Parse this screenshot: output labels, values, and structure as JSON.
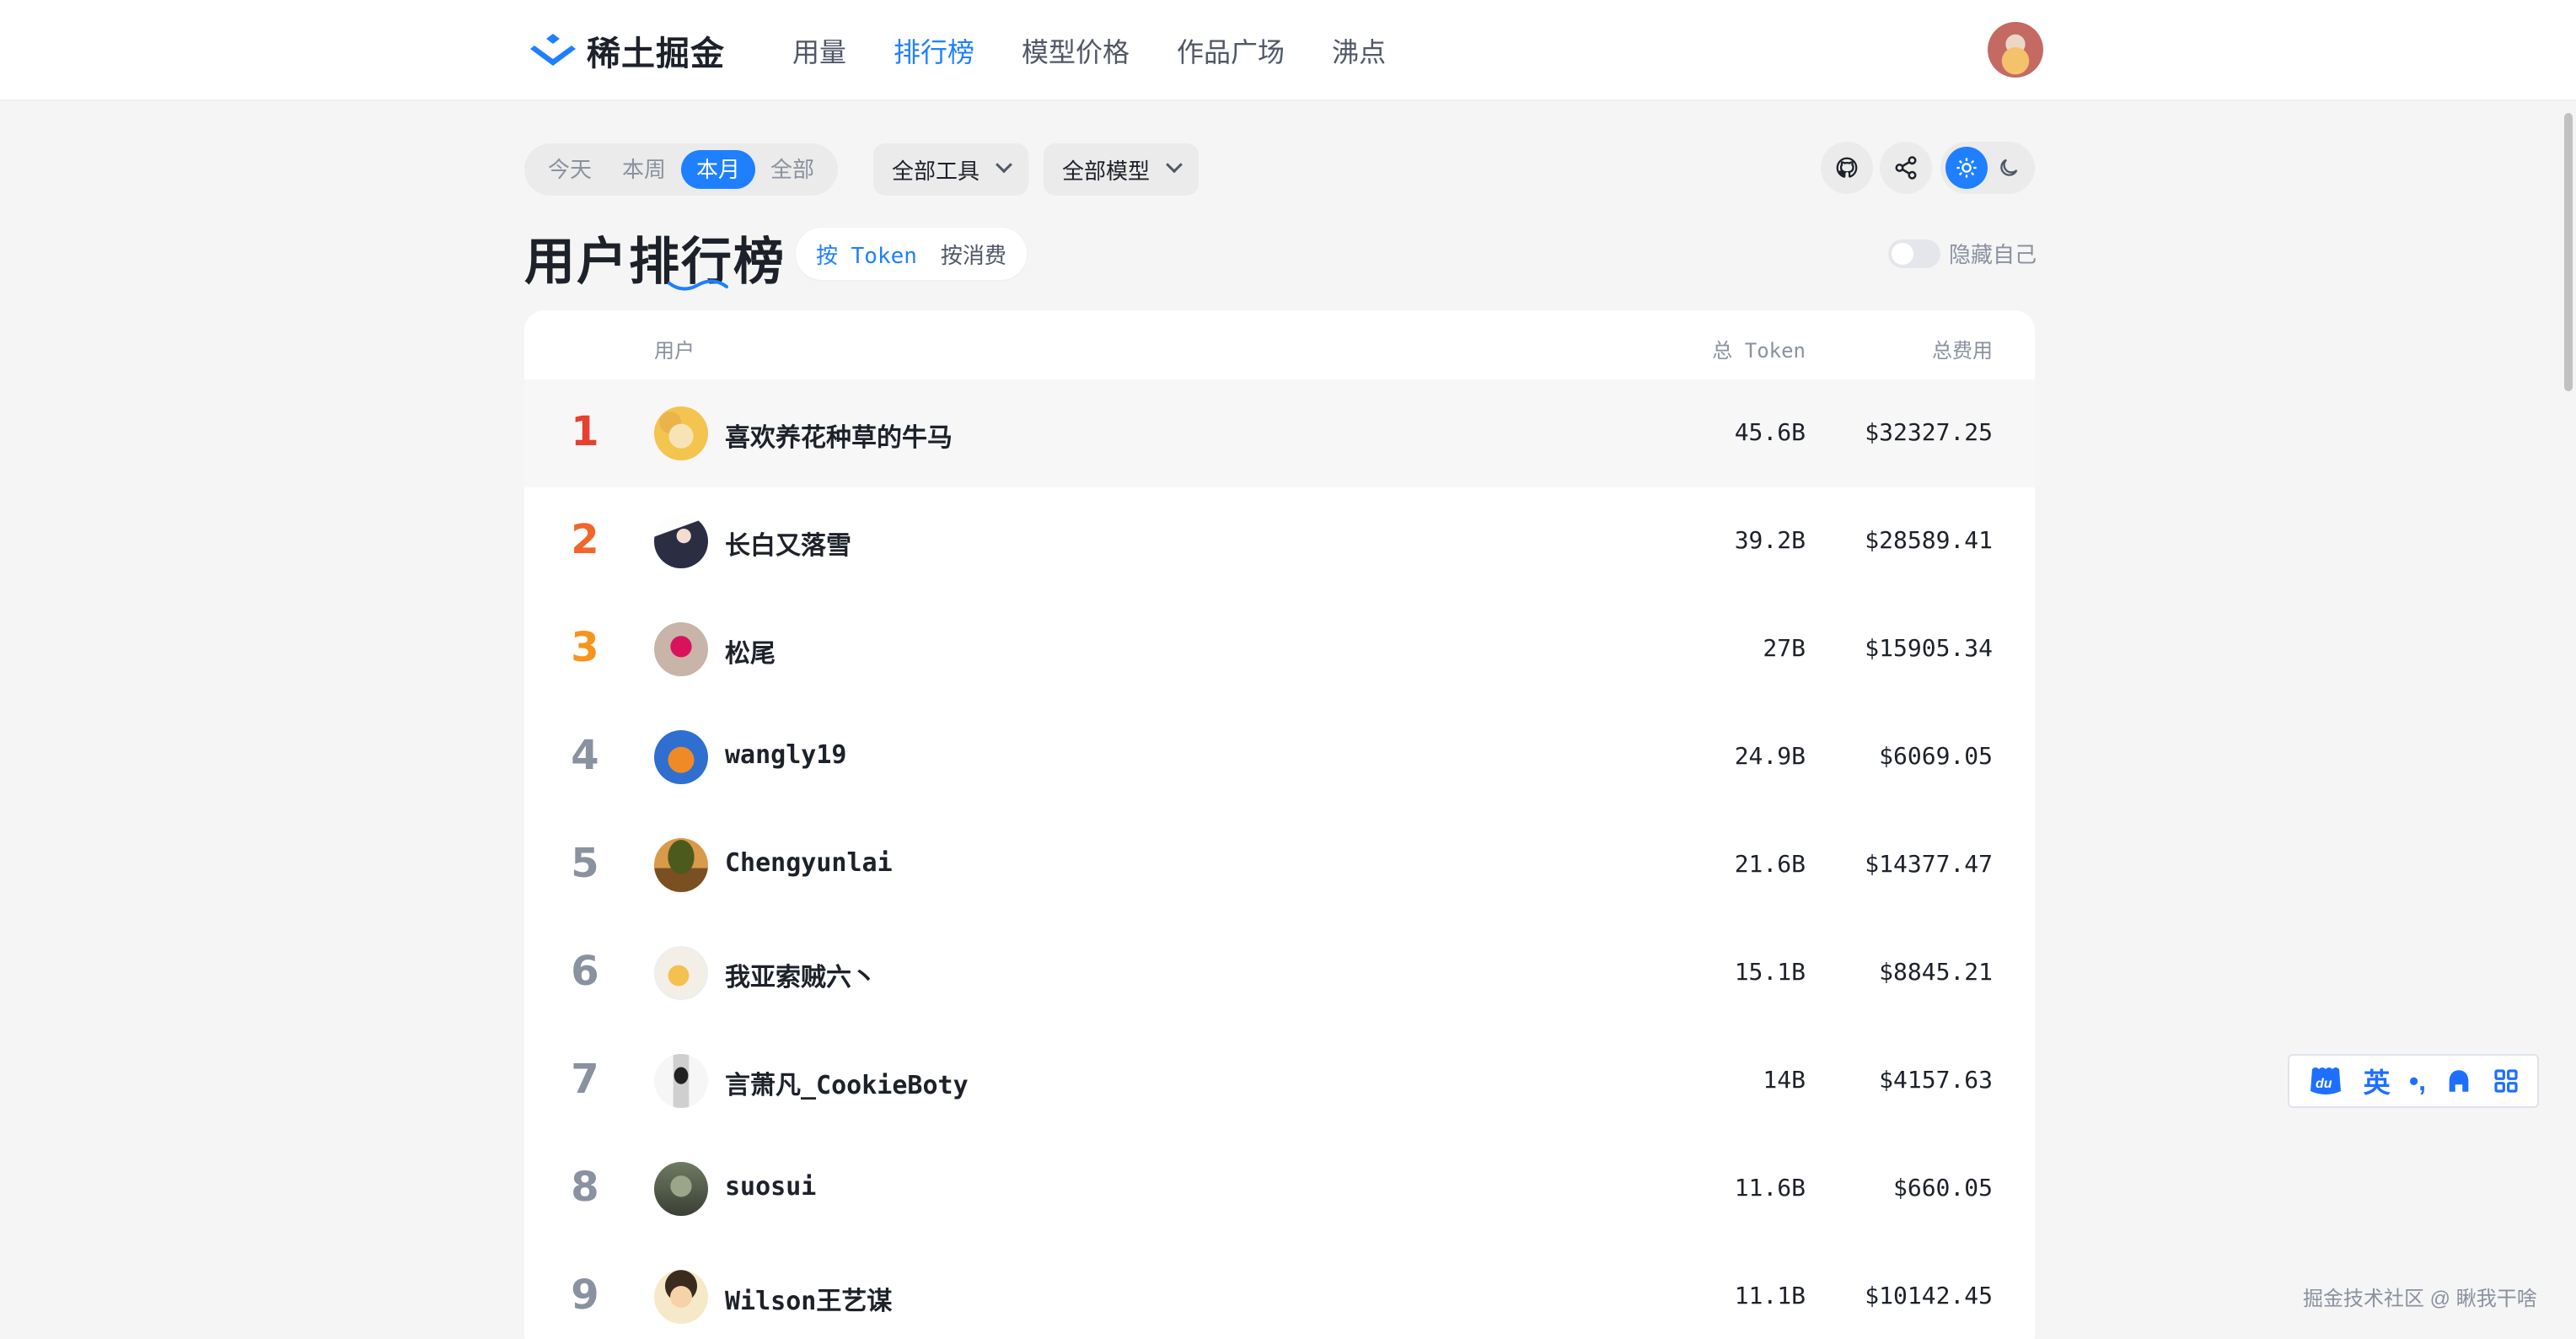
{
  "brand": {
    "name": "稀土掘金"
  },
  "nav": [
    {
      "label": "用量",
      "active": false
    },
    {
      "label": "排行榜",
      "active": true
    },
    {
      "label": "模型价格",
      "active": false
    },
    {
      "label": "作品广场",
      "active": false
    },
    {
      "label": "沸点",
      "active": false
    }
  ],
  "time_filter": [
    {
      "label": "今天",
      "active": false
    },
    {
      "label": "本周",
      "active": false
    },
    {
      "label": "本月",
      "active": true
    },
    {
      "label": "全部",
      "active": false
    }
  ],
  "tool_select": {
    "value": "全部工具"
  },
  "model_select": {
    "value": "全部模型"
  },
  "page_title": "用户排行榜",
  "sort": [
    {
      "label": "按 Token",
      "active": true
    },
    {
      "label": "按消费",
      "active": false
    }
  ],
  "hide_self": {
    "label": "隐藏自己",
    "on": false
  },
  "table": {
    "headers": {
      "user": "用户",
      "token": "总 Token",
      "cost": "总费用"
    },
    "rows": [
      {
        "rank": "1",
        "name": "喜欢养花种草的牛马",
        "token": "45.6B",
        "cost": "$32327.25",
        "highlight": true
      },
      {
        "rank": "2",
        "name": "长白又落雪",
        "token": "39.2B",
        "cost": "$28589.41"
      },
      {
        "rank": "3",
        "name": "松尾",
        "token": "27B",
        "cost": "$15905.34"
      },
      {
        "rank": "4",
        "name": "wangly19",
        "token": "24.9B",
        "cost": "$6069.05"
      },
      {
        "rank": "5",
        "name": "Chengyunlai",
        "token": "21.6B",
        "cost": "$14377.47"
      },
      {
        "rank": "6",
        "name": "我亚索贼六丶",
        "token": "15.1B",
        "cost": "$8845.21"
      },
      {
        "rank": "7",
        "name": "言萧凡_CookieBoty",
        "token": "14B",
        "cost": "$4157.63"
      },
      {
        "rank": "8",
        "name": "suosui",
        "token": "11.6B",
        "cost": "$660.05"
      },
      {
        "rank": "9",
        "name": "Wilson王艺谋",
        "token": "11.1B",
        "cost": "$10142.45"
      }
    ]
  },
  "ime": {
    "lang": "英",
    "punct": "•,"
  },
  "footer": {
    "credit": "掘金技术社区 @ 瞅我干啥"
  },
  "colors": {
    "accent": "#1e80ff",
    "rank1": "#e8402e",
    "rank2": "#f2662b",
    "rank3": "#f7941d"
  }
}
